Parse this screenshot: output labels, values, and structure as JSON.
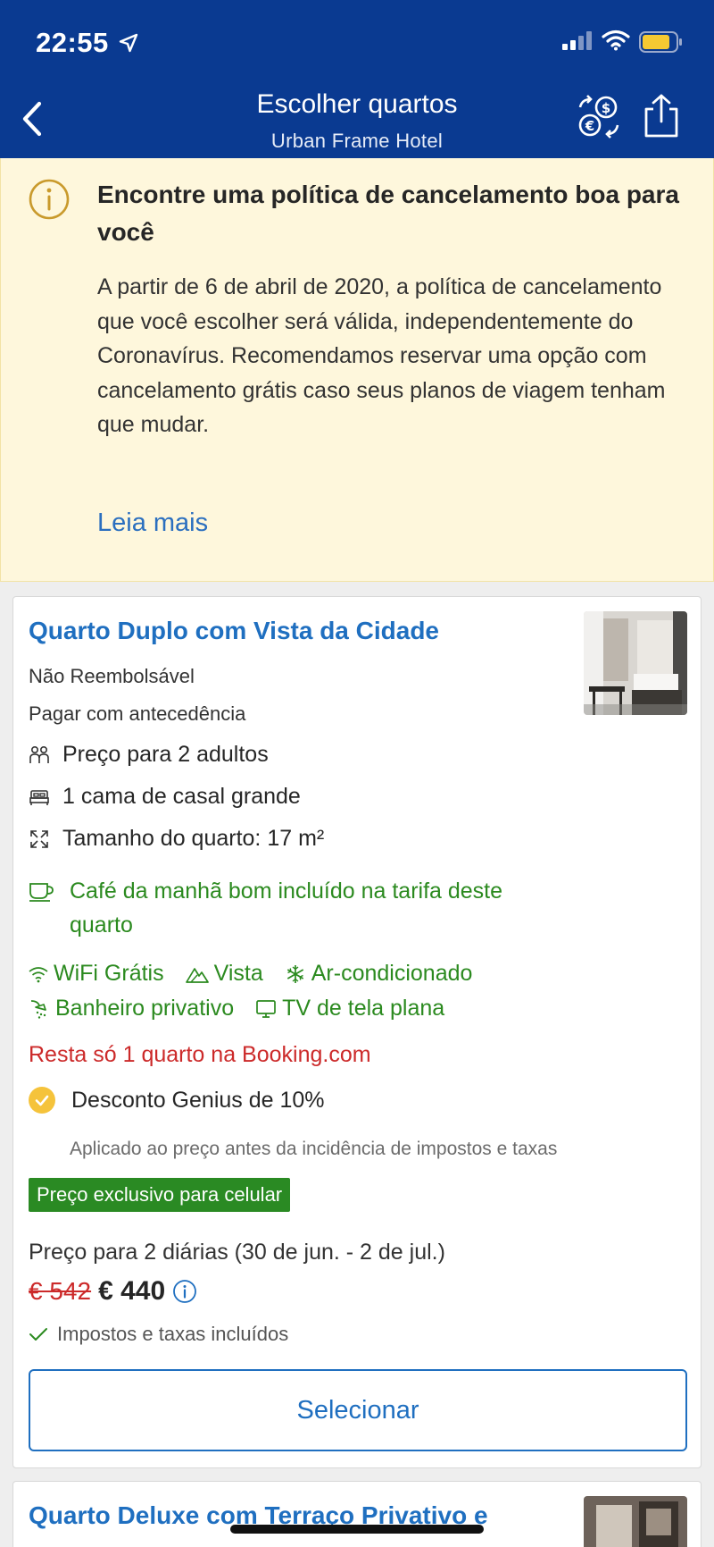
{
  "status_bar": {
    "time": "22:55"
  },
  "nav": {
    "title": "Escolher quartos",
    "subtitle": "Urban Frame Hotel",
    "back_icon": "chevron-left-icon",
    "currency_icon": "currency-exchange-icon",
    "share_icon": "share-icon"
  },
  "notice": {
    "title": "Encontre uma política de cancelamento boa para você",
    "body": "A partir de 6 de abril de 2020, a política de cancelamento que você escolher será válida, independentemente do Coronavírus. Recomendamos reservar uma opção com cancelamento grátis caso seus planos de viagem tenham que mudar.",
    "link": "Leia mais"
  },
  "room": {
    "title": "Quarto Duplo com Vista da Cidade",
    "policy": "Não Reembolsável",
    "payment": "Pagar com antecedência",
    "features": [
      {
        "icon": "people-icon",
        "text": "Preço para 2 adultos"
      },
      {
        "icon": "bed-icon",
        "text": "1 cama de casal grande"
      },
      {
        "icon": "expand-icon",
        "text": "Tamanho do quarto: 17 m²"
      }
    ],
    "breakfast": "Café da manhã bom incluído na tarifa deste quarto",
    "facilities": [
      {
        "icon": "wifi-icon",
        "text": "WiFi Grátis"
      },
      {
        "icon": "mountain-icon",
        "text": "Vista"
      },
      {
        "icon": "snowflake-icon",
        "text": "Ar-condicionado"
      },
      {
        "icon": "shower-icon",
        "text": "Banheiro privativo"
      },
      {
        "icon": "tv-icon",
        "text": "TV de tela plana"
      }
    ],
    "scarcity": "Resta só 1 quarto na Booking.com",
    "genius": "Desconto Genius de 10%",
    "genius_note": "Aplicado ao preço antes da incidência de impostos e taxas",
    "mobile_badge": "Preço exclusivo para celular",
    "price_for": "Preço para 2 diárias (30 de jun. - 2 de jul.)",
    "price_old": "€ 542",
    "price_new": "€ 440",
    "taxes": "Impostos e taxas incluídos",
    "select": "Selecionar"
  },
  "next_room": {
    "title": "Quarto Deluxe com Terraço Privativo e"
  },
  "colors": {
    "header": "#0a3a91",
    "link": "#1f6fc0",
    "green": "#2b8a1f",
    "red": "#cc2a2a",
    "notice_bg": "#fef7dc",
    "genius": "#f5c33b"
  }
}
